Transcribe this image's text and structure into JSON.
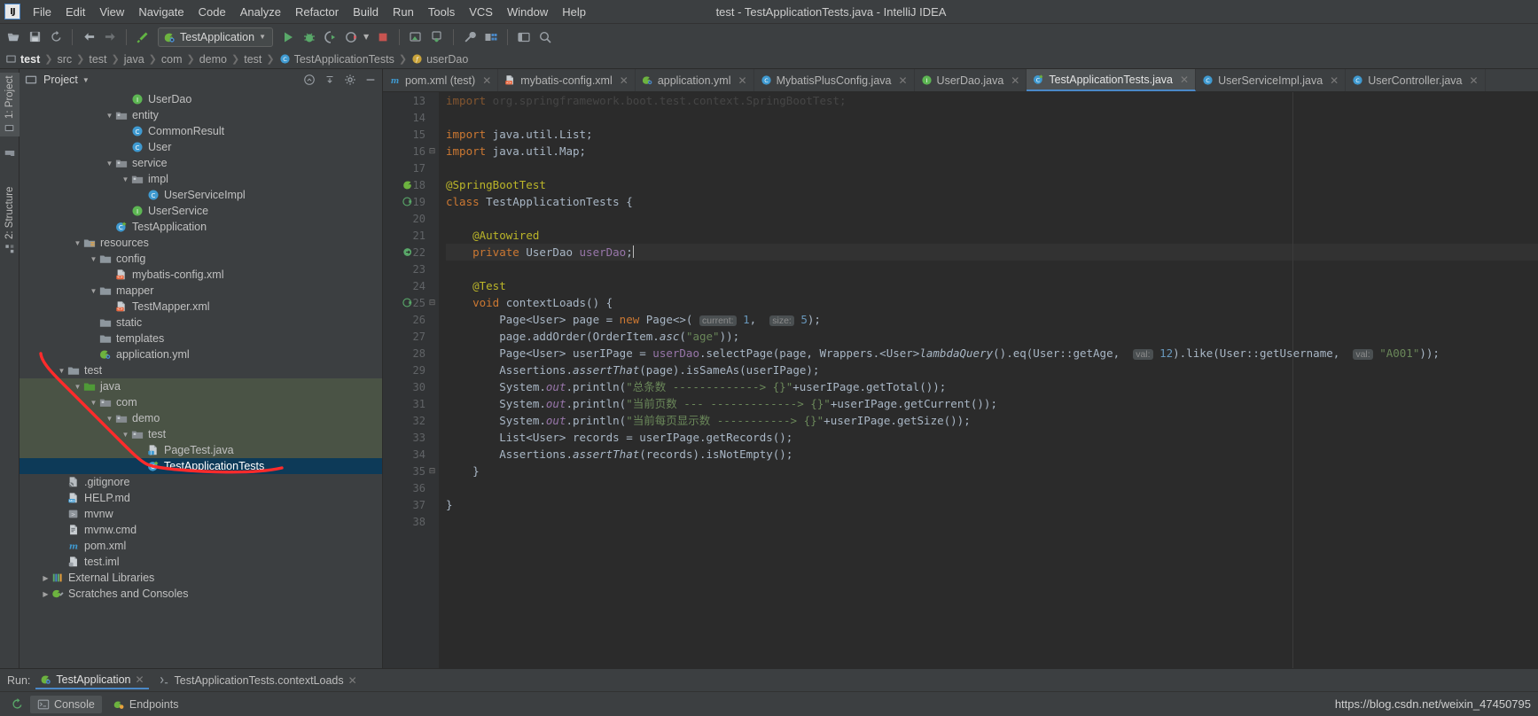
{
  "window": {
    "title": "test - TestApplicationTests.java - IntelliJ IDEA"
  },
  "menubar": {
    "logo": "IJ",
    "items": [
      {
        "label": "File",
        "name": "menu-file"
      },
      {
        "label": "Edit",
        "name": "menu-edit"
      },
      {
        "label": "View",
        "name": "menu-view"
      },
      {
        "label": "Navigate",
        "name": "menu-navigate"
      },
      {
        "label": "Code",
        "name": "menu-code"
      },
      {
        "label": "Analyze",
        "name": "menu-analyze"
      },
      {
        "label": "Refactor",
        "name": "menu-refactor"
      },
      {
        "label": "Build",
        "name": "menu-build"
      },
      {
        "label": "Run",
        "name": "menu-run"
      },
      {
        "label": "Tools",
        "name": "menu-tools"
      },
      {
        "label": "VCS",
        "name": "menu-vcs"
      },
      {
        "label": "Window",
        "name": "menu-window"
      },
      {
        "label": "Help",
        "name": "menu-help"
      }
    ]
  },
  "toolbar": {
    "run_configuration": "TestApplication",
    "icons": [
      "open-folder-icon",
      "save-icon",
      "sync-icon",
      "back-arrow-icon",
      "forward-arrow-icon",
      "build-hammer-icon",
      "run-icon",
      "debug-icon",
      "run-with-coverage-icon",
      "profiler-icon",
      "stop-icon",
      "update-project-icon",
      "commit-icon",
      "wrench-settings-icon",
      "project-structure-icon",
      "layout-icon",
      "search-everywhere-icon"
    ]
  },
  "breadcrumb": {
    "items": [
      {
        "label": "test",
        "icon": "module-icon",
        "bold": true
      },
      {
        "label": "src",
        "icon": "",
        "bold": false
      },
      {
        "label": "test",
        "icon": "",
        "bold": false
      },
      {
        "label": "java",
        "icon": "",
        "bold": false
      },
      {
        "label": "com",
        "icon": "",
        "bold": false
      },
      {
        "label": "demo",
        "icon": "",
        "bold": false
      },
      {
        "label": "test",
        "icon": "",
        "bold": false
      },
      {
        "label": "TestApplicationTests",
        "icon": "class-icon",
        "bold": false
      },
      {
        "label": "userDao",
        "icon": "field-icon",
        "bold": false
      }
    ]
  },
  "left_strip": {
    "tabs": [
      {
        "label": "1: Project",
        "name": "tool-window-project",
        "selected": true
      },
      {
        "label": "2: Structure",
        "name": "tool-window-structure",
        "selected": false
      }
    ]
  },
  "project_panel": {
    "title": "Project",
    "header_icons": [
      "collapse-all-icon",
      "expand-all-icon",
      "gear-icon",
      "hide-icon"
    ],
    "tree": [
      {
        "label": "UserDao",
        "indent": 6,
        "arrow": "",
        "icon": "interface-icon",
        "state": "normal"
      },
      {
        "label": "entity",
        "indent": 5,
        "arrow": "▼",
        "icon": "package-icon",
        "state": "normal"
      },
      {
        "label": "CommonResult",
        "indent": 6,
        "arrow": "",
        "icon": "class-icon",
        "state": "normal"
      },
      {
        "label": "User",
        "indent": 6,
        "arrow": "",
        "icon": "class-icon",
        "state": "normal"
      },
      {
        "label": "service",
        "indent": 5,
        "arrow": "▼",
        "icon": "package-icon",
        "state": "normal"
      },
      {
        "label": "impl",
        "indent": 6,
        "arrow": "▼",
        "icon": "package-icon",
        "state": "normal"
      },
      {
        "label": "UserServiceImpl",
        "indent": 7,
        "arrow": "",
        "icon": "class-icon",
        "state": "normal"
      },
      {
        "label": "UserService",
        "indent": 6,
        "arrow": "",
        "icon": "interface-icon",
        "state": "normal"
      },
      {
        "label": "TestApplication",
        "indent": 5,
        "arrow": "",
        "icon": "spring-class-icon",
        "state": "normal"
      },
      {
        "label": "resources",
        "indent": 3,
        "arrow": "▼",
        "icon": "resources-icon",
        "state": "normal"
      },
      {
        "label": "config",
        "indent": 4,
        "arrow": "▼",
        "icon": "folder-icon",
        "state": "normal"
      },
      {
        "label": "mybatis-config.xml",
        "indent": 5,
        "arrow": "",
        "icon": "xml-icon",
        "state": "normal"
      },
      {
        "label": "mapper",
        "indent": 4,
        "arrow": "▼",
        "icon": "folder-icon",
        "state": "normal"
      },
      {
        "label": "TestMapper.xml",
        "indent": 5,
        "arrow": "",
        "icon": "xml-icon",
        "state": "normal"
      },
      {
        "label": "static",
        "indent": 4,
        "arrow": "",
        "icon": "folder-icon",
        "state": "normal"
      },
      {
        "label": "templates",
        "indent": 4,
        "arrow": "",
        "icon": "folder-icon",
        "state": "normal"
      },
      {
        "label": "application.yml",
        "indent": 4,
        "arrow": "",
        "icon": "spring-yml-icon",
        "state": "normal"
      },
      {
        "label": "test",
        "indent": 2,
        "arrow": "▼",
        "icon": "folder-icon",
        "state": "normal"
      },
      {
        "label": "java",
        "indent": 3,
        "arrow": "▼",
        "icon": "test-source-icon",
        "state": "green"
      },
      {
        "label": "com",
        "indent": 4,
        "arrow": "▼",
        "icon": "package-icon",
        "state": "green"
      },
      {
        "label": "demo",
        "indent": 5,
        "arrow": "▼",
        "icon": "package-icon",
        "state": "green"
      },
      {
        "label": "test",
        "indent": 6,
        "arrow": "▼",
        "icon": "package-icon",
        "state": "green"
      },
      {
        "label": "PageTest.java",
        "indent": 7,
        "arrow": "",
        "icon": "java-file-icon",
        "state": "green"
      },
      {
        "label": "TestApplicationTests",
        "indent": 7,
        "arrow": "",
        "icon": "spring-class-icon",
        "state": "selected"
      },
      {
        "label": ".gitignore",
        "indent": 2,
        "arrow": "",
        "icon": "gitignore-icon",
        "state": "normal"
      },
      {
        "label": "HELP.md",
        "indent": 2,
        "arrow": "",
        "icon": "markdown-icon",
        "state": "normal"
      },
      {
        "label": "mvnw",
        "indent": 2,
        "arrow": "",
        "icon": "script-icon",
        "state": "normal"
      },
      {
        "label": "mvnw.cmd",
        "indent": 2,
        "arrow": "",
        "icon": "cmd-icon",
        "state": "normal"
      },
      {
        "label": "pom.xml",
        "indent": 2,
        "arrow": "",
        "icon": "maven-icon",
        "state": "normal"
      },
      {
        "label": "test.iml",
        "indent": 2,
        "arrow": "",
        "icon": "iml-icon",
        "state": "normal"
      },
      {
        "label": "External Libraries",
        "indent": 1,
        "arrow": "▶",
        "icon": "libraries-icon",
        "state": "normal"
      },
      {
        "label": "Scratches and Consoles",
        "indent": 1,
        "arrow": "▶",
        "icon": "scratches-icon",
        "state": "normal"
      }
    ]
  },
  "editor": {
    "tabs": [
      {
        "label": "pom.xml (test)",
        "icon": "maven-icon",
        "active": false
      },
      {
        "label": "mybatis-config.xml",
        "icon": "xml-icon",
        "active": false
      },
      {
        "label": "application.yml",
        "icon": "spring-yml-icon",
        "active": false
      },
      {
        "label": "MybatisPlusConfig.java",
        "icon": "class-icon",
        "active": false
      },
      {
        "label": "UserDao.java",
        "icon": "interface-icon",
        "active": false
      },
      {
        "label": "TestApplicationTests.java",
        "icon": "spring-class-icon",
        "active": true
      },
      {
        "label": "UserServiceImpl.java",
        "icon": "class-icon",
        "active": false
      },
      {
        "label": "UserController.java",
        "icon": "class-icon",
        "active": false
      }
    ],
    "first_line_number": 13,
    "lines": [
      {
        "n": 13,
        "mark": "",
        "fold": "",
        "text": "import org.springframework.boot.test.context.SpringBootTest;",
        "clipped": true
      },
      {
        "n": 14,
        "mark": "",
        "fold": "",
        "text": ""
      },
      {
        "n": 15,
        "mark": "",
        "fold": "",
        "text": "import java.util.List;"
      },
      {
        "n": 16,
        "mark": "",
        "fold": "⊟",
        "text": "import java.util.Map;"
      },
      {
        "n": 17,
        "mark": "",
        "fold": "",
        "text": ""
      },
      {
        "n": 18,
        "mark": "spring-leaf-icon",
        "fold": "",
        "text": "@SpringBootTest"
      },
      {
        "n": 19,
        "mark": "run-test-icon",
        "fold": "",
        "text": "class TestApplicationTests {"
      },
      {
        "n": 20,
        "mark": "",
        "fold": "",
        "text": ""
      },
      {
        "n": 21,
        "mark": "",
        "fold": "",
        "text": "    @Autowired"
      },
      {
        "n": 22,
        "mark": "bean-icon",
        "fold": "",
        "text": "    private UserDao userDao;",
        "caret": true,
        "current": true
      },
      {
        "n": 23,
        "mark": "",
        "fold": "",
        "text": ""
      },
      {
        "n": 24,
        "mark": "",
        "fold": "",
        "text": "    @Test"
      },
      {
        "n": 25,
        "mark": "run-test-icon",
        "fold": "⊟",
        "text": "    void contextLoads() {"
      },
      {
        "n": 26,
        "mark": "",
        "fold": "",
        "text": "        Page<User> page = new Page<>( current: 1,  size: 5);"
      },
      {
        "n": 27,
        "mark": "",
        "fold": "",
        "text": "        page.addOrder(OrderItem.asc(\"age\"));"
      },
      {
        "n": 28,
        "mark": "",
        "fold": "",
        "text": "        Page<User> userIPage = userDao.selectPage(page, Wrappers.<User>lambdaQuery().eq(User::getAge,  val: 12).like(User::getUsername,  val: \"A001\"));"
      },
      {
        "n": 29,
        "mark": "",
        "fold": "",
        "text": "        Assertions.assertThat(page).isSameAs(userIPage);"
      },
      {
        "n": 30,
        "mark": "",
        "fold": "",
        "text": "        System.out.println(\"总条数 -------------> {}\"+userIPage.getTotal());"
      },
      {
        "n": 31,
        "mark": "",
        "fold": "",
        "text": "        System.out.println(\"当前页数 --- -------------> {}\"+userIPage.getCurrent());"
      },
      {
        "n": 32,
        "mark": "",
        "fold": "",
        "text": "        System.out.println(\"当前每页显示数 -----------> {}\"+userIPage.getSize());"
      },
      {
        "n": 33,
        "mark": "",
        "fold": "",
        "text": "        List<User> records = userIPage.getRecords();"
      },
      {
        "n": 34,
        "mark": "",
        "fold": "",
        "text": "        Assertions.assertThat(records).isNotEmpty();"
      },
      {
        "n": 35,
        "mark": "",
        "fold": "⊟",
        "text": "    }"
      },
      {
        "n": 36,
        "mark": "",
        "fold": "",
        "text": ""
      },
      {
        "n": 37,
        "mark": "",
        "fold": "",
        "text": "}"
      },
      {
        "n": 38,
        "mark": "",
        "fold": "",
        "text": ""
      }
    ]
  },
  "run_panel": {
    "label": "Run:",
    "tabs": [
      {
        "label": "TestApplication",
        "icon": "spring-run-icon",
        "active": true
      },
      {
        "label": "TestApplicationTests.contextLoads",
        "icon": "test-run-icon",
        "active": false
      }
    ]
  },
  "status_bar": {
    "buttons": [
      {
        "label": "Console",
        "icon": "console-icon",
        "active": true
      },
      {
        "label": "Endpoints",
        "icon": "endpoints-icon",
        "active": false
      }
    ],
    "restart_icon": "rerun-icon",
    "watermark": "https://blog.csdn.net/weixin_47450795"
  },
  "colors": {
    "accent_blue": "#4a88c7",
    "selection_blue": "#0d3a58",
    "test_source_green": "#4a5345",
    "annotation_red": "#ff2b2b",
    "editor_bg": "#2b2b2b",
    "panel_bg": "#3c3f41"
  }
}
